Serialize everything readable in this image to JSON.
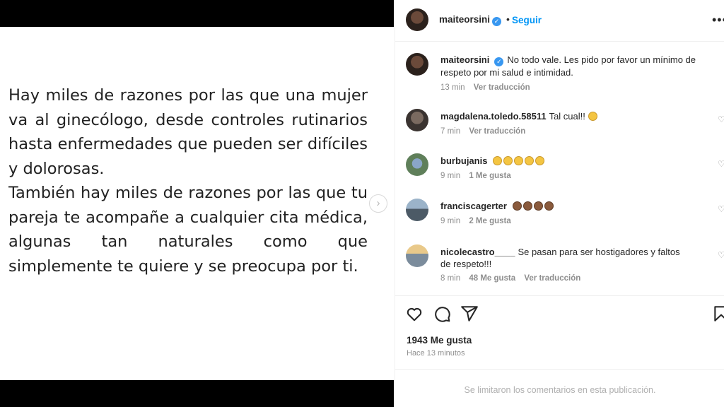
{
  "media": {
    "paragraph1": "Hay miles de razones por las que una mujer va al ginecólogo, desde controles rutinarios hasta enfermedades que pueden ser difíciles y dolorosas.",
    "paragraph2": "También hay miles de razones por las que tu pareja te acompañe a cualquier cita médica, algunas tan naturales como que simplemente te quiere y se preocupa por ti.",
    "next_icon": "chevron-right-icon",
    "next_glyph": "›"
  },
  "header": {
    "username": "maiteorsini",
    "verified_glyph": "✓",
    "dot": "•",
    "follow_label": "Seguir",
    "more_glyph": "•••"
  },
  "caption": {
    "username": "maiteorsini",
    "text": "No todo vale. Les pido por favor un mínimo de respeto por mi salud e intimidad.",
    "time": "13 min",
    "translate": "Ver traducción"
  },
  "comments": [
    {
      "username": "magdalena.toledo.58511",
      "text": "Tal cual!!",
      "emojis": 1,
      "emoji_tone": "y",
      "time": "7 min",
      "likes": "",
      "translate": "Ver traducción"
    },
    {
      "username": "burbujanis",
      "text": "",
      "emojis": 5,
      "emoji_tone": "y",
      "time": "9 min",
      "likes": "1 Me gusta",
      "translate": ""
    },
    {
      "username": "franciscagerter",
      "text": "",
      "emojis": 4,
      "emoji_tone": "b",
      "time": "9 min",
      "likes": "2 Me gusta",
      "translate": ""
    },
    {
      "username": "nicolecastro____",
      "text": "Se pasan para ser hostigadores y faltos de respeto!!!",
      "emojis": 0,
      "emoji_tone": "y",
      "time": "8 min",
      "likes": "48 Me gusta",
      "translate": "Ver traducción"
    }
  ],
  "actions": {
    "like_icon": "heart-icon",
    "comment_icon": "comment-icon",
    "share_icon": "share-icon",
    "save_icon": "bookmark-icon",
    "likes_count": "1943 Me gusta",
    "timestamp": "Hace 13 minutos"
  },
  "footer": {
    "notice": "Se limitaron los comentarios en esta publicación."
  },
  "colors": {
    "link_blue": "#0095f6",
    "verified_blue": "#3897f0",
    "muted": "#8e8e8e"
  }
}
